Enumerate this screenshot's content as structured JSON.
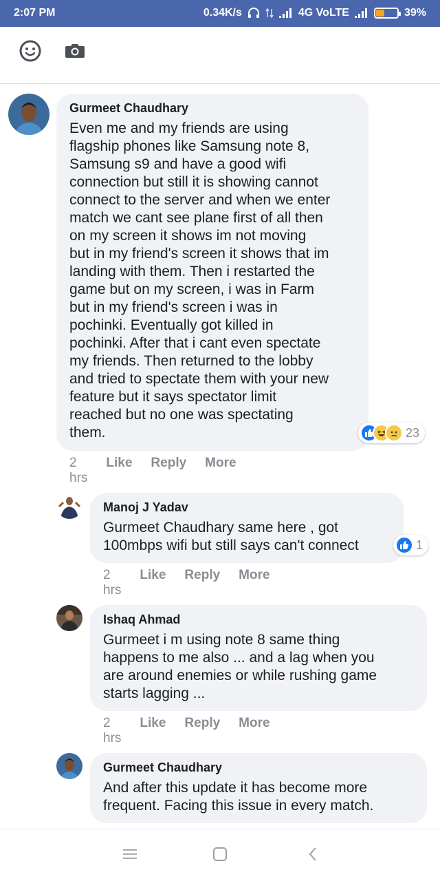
{
  "status_bar": {
    "time": "2:07 PM",
    "network_speed": "0.34K/s",
    "network_type": "4G VoLTE",
    "battery_percent": "39%",
    "battery_level": 0.39,
    "accent_color": "#4a67ad"
  },
  "toolbar": {
    "icons": [
      "emoji-icon",
      "camera-icon"
    ]
  },
  "comments": [
    {
      "author": "Gurmeet Chaudhary",
      "text": "Even me and my friends are using\nflagship phones like Samsung note 8,\nSamsung s9 and have a good wifi\nconnection but still it is showing cannot\nconnect to the server and when we enter\nmatch we cant see plane first of all then\non my screen it shows im not moving\nbut in my friend's screen it shows that im\nlanding with them. Then i restarted the\ngame but on my screen, i was in Farm\nbut in my friend's screen i was in\npochinki. Eventually got killed in\npochinki. After that i cant even spectate\nmy friends. Then returned to the lobby\nand tried to spectate them with your new\nfeature but it says spectator limit\nreached but no one was spectating\nthem.",
      "time": "2 hrs",
      "like": "Like",
      "reply": "Reply",
      "more": "More",
      "reaction_count": "23",
      "reaction_icons": [
        "like-icon",
        "haha-icon",
        "sad-icon"
      ]
    },
    {
      "author": "Manoj J Yadav",
      "text": "Gurmeet Chaudhary same here , got\n100mbps wifi but still says can't connect",
      "time": "2 hrs",
      "like": "Like",
      "reply": "Reply",
      "more": "More",
      "reaction_count": "1",
      "reaction_icons": [
        "like-icon"
      ]
    },
    {
      "author": "Ishaq Ahmad",
      "text": "Gurmeet i m using note 8 same thing\nhappens to me also ... and a lag when you\nare around enemies or while rushing game\nstarts lagging ...",
      "time": "2 hrs",
      "like": "Like",
      "reply": "Reply",
      "more": "More"
    },
    {
      "author": "Gurmeet Chaudhary",
      "text": "And after this update it has become more\nfrequent. Facing this issue in every match."
    }
  ],
  "nav": {
    "icons": [
      "menu-icon",
      "home-icon",
      "back-icon"
    ]
  }
}
